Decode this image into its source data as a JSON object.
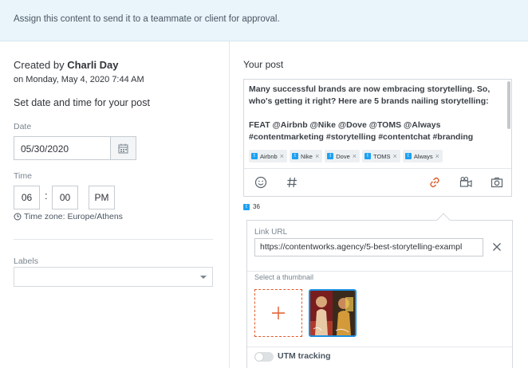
{
  "banner": {
    "text": "Assign this content to send it to a teammate or client for approval."
  },
  "left": {
    "created_prefix": "Created by",
    "created_name": "Charli Day",
    "created_date": "on Monday, May 4, 2020 7:44 AM",
    "set_title": "Set date and time for your post",
    "date_label": "Date",
    "date_value": "05/30/2020",
    "time_label": "Time",
    "hour": "06",
    "minute": "00",
    "ampm": "PM",
    "timezone": "Time zone: Europe/Athens",
    "labels_label": "Labels",
    "labels_value": ""
  },
  "right": {
    "title": "Your post",
    "post_text": "Many successful brands are now embracing storytelling. So, who's getting it right? Here are 5 brands nailing storytelling:\n\nFEAT @Airbnb @Nike @Dove @TOMS @Always\n#contentmarketing #storytelling #contentchat #branding",
    "tags": [
      "Airbnb",
      "Nike",
      "Dove",
      "TOMS",
      "Always"
    ],
    "char_count": "36",
    "link_label": "Link URL",
    "link_value": "https://contentworks.agency/5-best-storytelling-exampl",
    "thumbnail_label": "Select a thumbnail",
    "utm_label": "UTM tracking",
    "utm_enabled": false
  },
  "colors": {
    "accent": "#e05a2b",
    "twitter": "#1da1f2",
    "selected": "#1a8fe0",
    "banner_bg": "#e9f5fb"
  },
  "icons": [
    "calendar-icon",
    "clock-icon",
    "emoji-icon",
    "hashtag-icon",
    "link-icon",
    "video-icon",
    "camera-icon",
    "twitter-icon",
    "close-icon",
    "plus-icon"
  ]
}
